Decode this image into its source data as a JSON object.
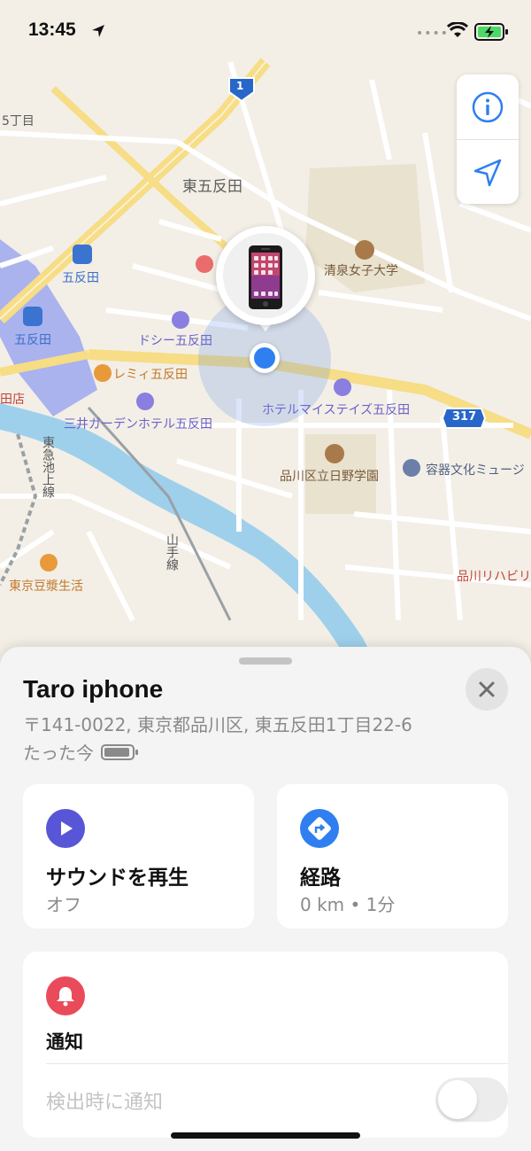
{
  "status_bar": {
    "time": "13:45",
    "dots": "••••"
  },
  "map": {
    "labels": {
      "chome": "5丁目",
      "higashi_gotanda": "東五反田",
      "seisen": "清泉女子大学",
      "gotanda_1": "五反田",
      "gotanda_2": "五反田",
      "dormy": "ドシー五反田",
      "remy": "レミィ五反田",
      "mitsui": "三井ガーデンホテル五反田",
      "mystays": "ホテルマイステイズ五反田",
      "hinodegakuen": "品川区立日野学園",
      "container_museum": "容器文化ミュージ",
      "tokyu_ikegami": "東急池上線",
      "yamanote": "山手線",
      "tofu": "東京豆漿生活",
      "shinagawa_rehab": "品川リハビリ",
      "store": "田店",
      "route_1": "1",
      "route_317": "317"
    }
  },
  "device": {
    "name": "Taro iphone",
    "address": "〒141-0022, 東京都品川区, 東五反田1丁目22-6",
    "updated": "たった今"
  },
  "actions": {
    "sound": {
      "title": "サウンドを再生",
      "sub": "オフ"
    },
    "route": {
      "title": "経路",
      "sub": "0 km • 1分"
    }
  },
  "notify": {
    "title": "通知",
    "toggle_label": "検出時に通知",
    "enabled": false
  },
  "colors": {
    "accent_blue": "#2f7ff0",
    "sound_purple": "#5856d6",
    "notify_red": "#ea4b5a"
  }
}
